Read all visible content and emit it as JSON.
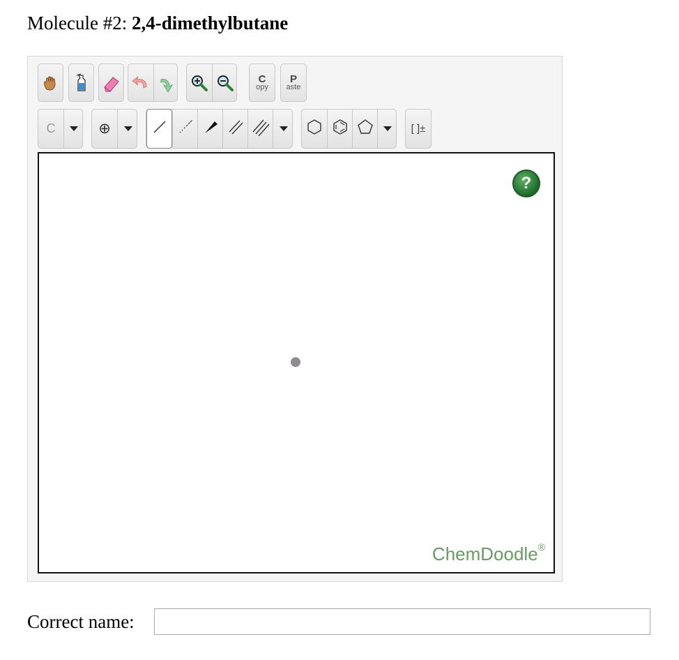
{
  "question": {
    "prefix": "Molecule #2: ",
    "molecule_name": "2,4-dimethylbutane"
  },
  "toolbar": {
    "row1": [
      {
        "name": "pan-tool",
        "icon": "hand-icon"
      },
      {
        "name": "lasso-select",
        "icon": "select-bottle-icon"
      },
      {
        "name": "eraser",
        "icon": "eraser-icon"
      },
      {
        "name": "undo",
        "icon": "undo-arrow-icon"
      },
      {
        "name": "redo",
        "icon": "redo-arrow-icon"
      },
      {
        "name": "zoom-in",
        "icon": "zoom-in-icon"
      },
      {
        "name": "zoom-out",
        "icon": "zoom-out-icon"
      }
    ],
    "copy": {
      "big": "C",
      "small": "opy"
    },
    "paste": {
      "big": "P",
      "small": "aste"
    },
    "atom_label": "C",
    "charge_label": "⊕",
    "bracket_label": "[ ]±"
  },
  "canvas": {
    "help_label": "?",
    "brand": "ChemDoodle",
    "brand_mark": "®"
  },
  "answer": {
    "label": "Correct name:",
    "value": ""
  },
  "colors": {
    "brand": "#6a9a64",
    "help": "#2e7d32",
    "dot": "#8f8c8f"
  }
}
